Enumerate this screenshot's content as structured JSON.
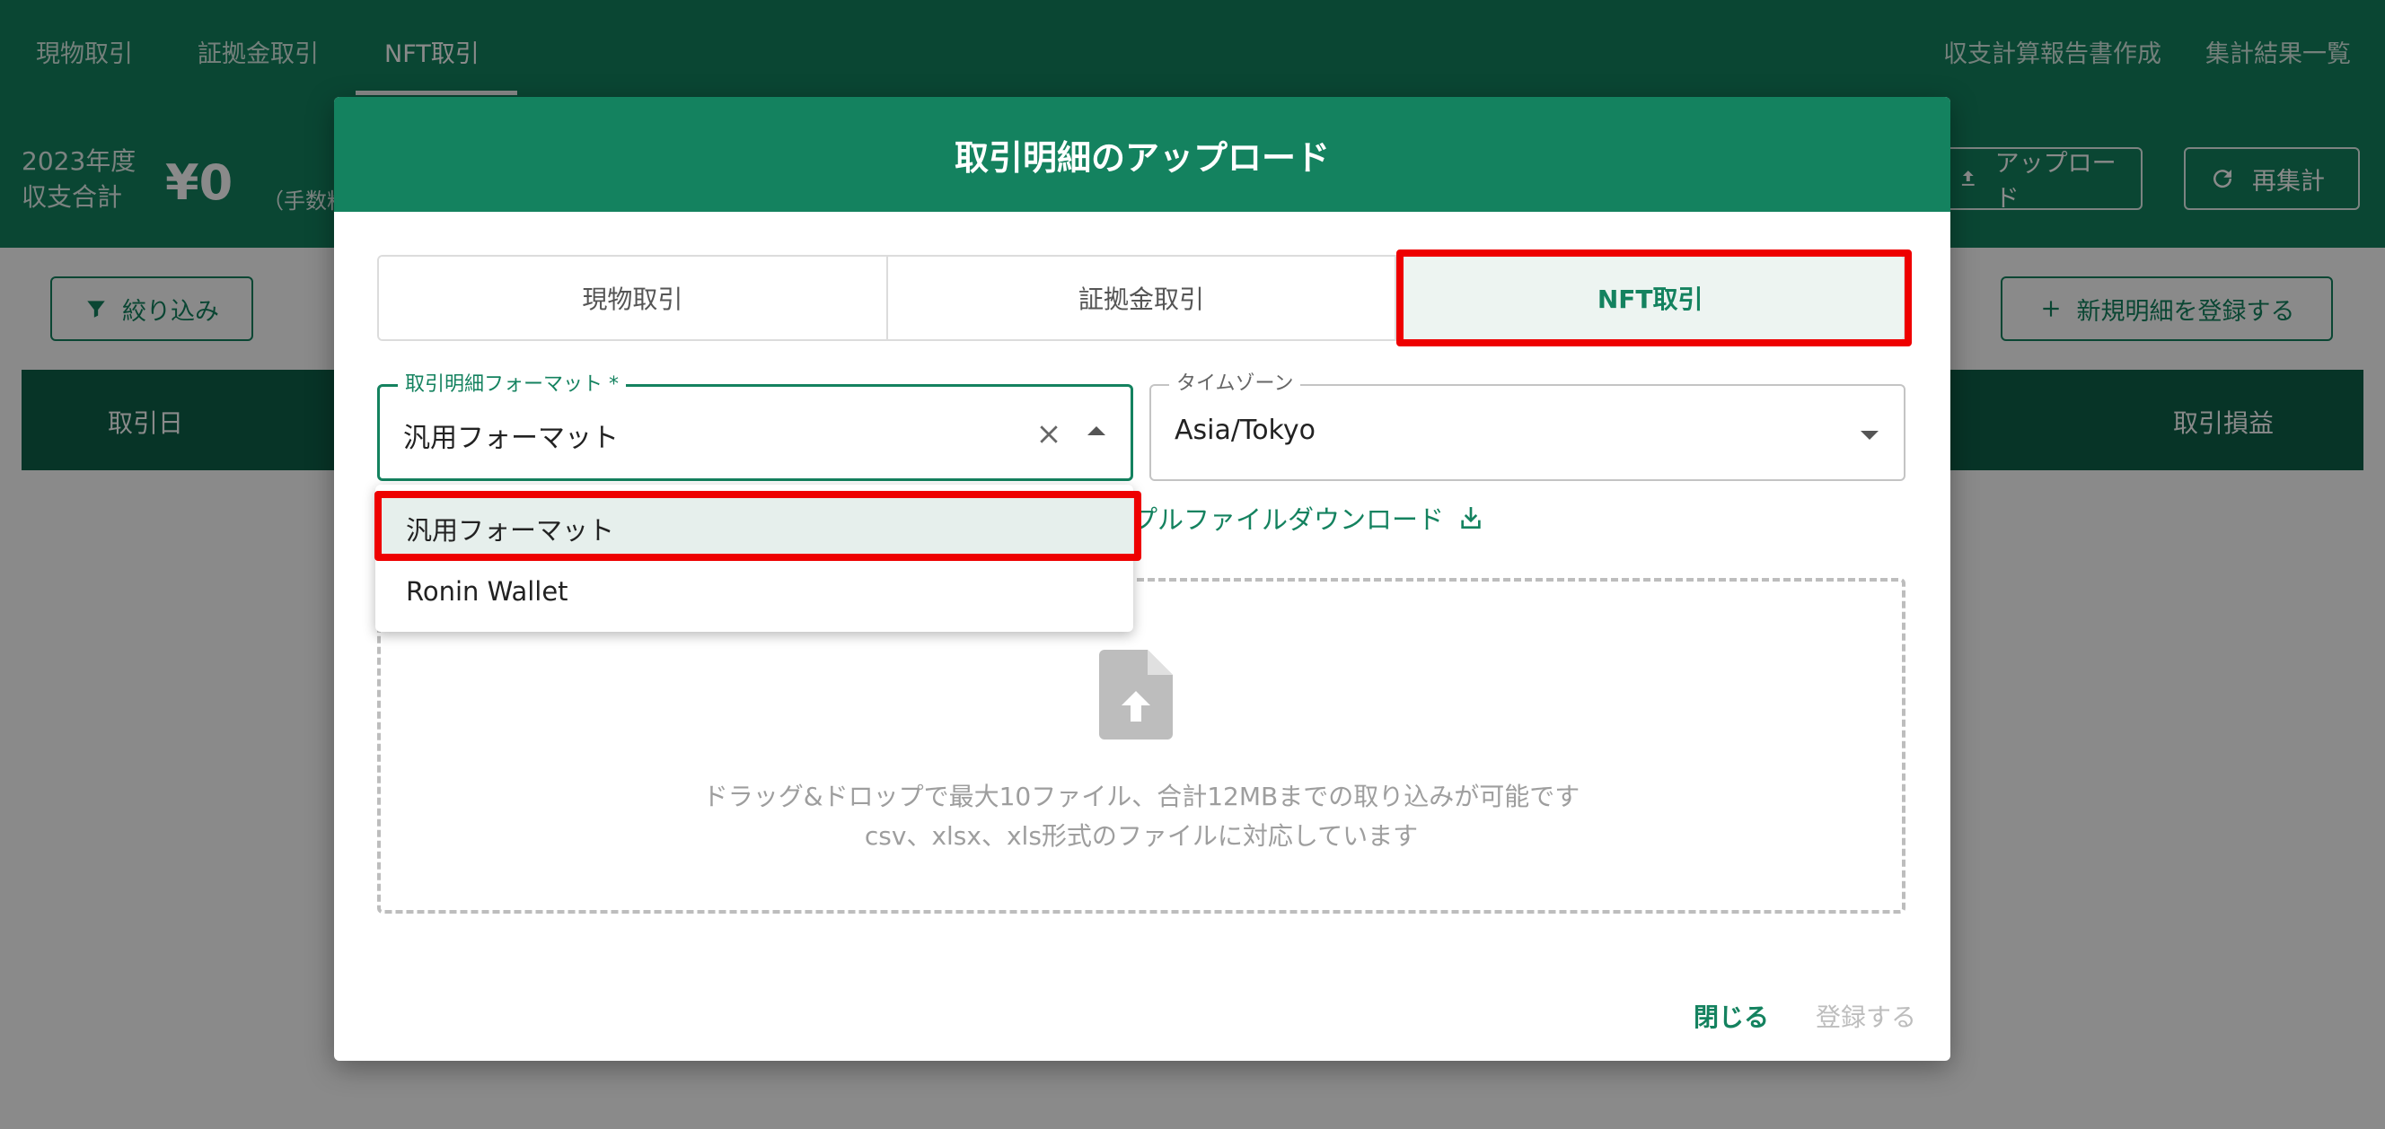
{
  "nav": {
    "tabs": [
      "現物取引",
      "証拠金取引",
      "NFT取引"
    ],
    "right_links": [
      "収支計算報告書作成",
      "集計結果一覧"
    ]
  },
  "summary": {
    "year": "2023年度",
    "label": "収支合計",
    "amount": "¥0",
    "note": "（手数料",
    "upload_label": "アップロード",
    "recalc_label": "再集計"
  },
  "toolbar": {
    "filter_label": "絞り込み",
    "new_label": "新規明細を登録する"
  },
  "table": {
    "headers": [
      "取引日",
      "取引損益"
    ]
  },
  "modal": {
    "title": "取引明細のアップロード",
    "tabs": [
      {
        "label": "現物取引",
        "active": false
      },
      {
        "label": "証拠金取引",
        "active": false
      },
      {
        "label": "NFT取引",
        "active": true
      }
    ],
    "format_field": {
      "label": "取引明細フォーマット *",
      "value": "汎用フォーマット"
    },
    "timezone_field": {
      "label": "タイムゾーン",
      "value": "Asia/Tokyo"
    },
    "sample_link": "プルファイルダウンロード",
    "dropzone": {
      "line1": "ドラッグ&ドロップで最大10ファイル、合計12MBまでの取り込みが可能です",
      "line2": "csv、xlsx、xls形式のファイルに対応しています"
    },
    "close_label": "閉じる",
    "submit_label": "登録する"
  },
  "format_options": [
    {
      "label": "汎用フォーマット",
      "selected": true
    },
    {
      "label": "Ronin Wallet",
      "selected": false
    }
  ],
  "colors": {
    "brand": "#14825f",
    "brand_dark": "#0d6149",
    "highlight": "#ee0000"
  }
}
